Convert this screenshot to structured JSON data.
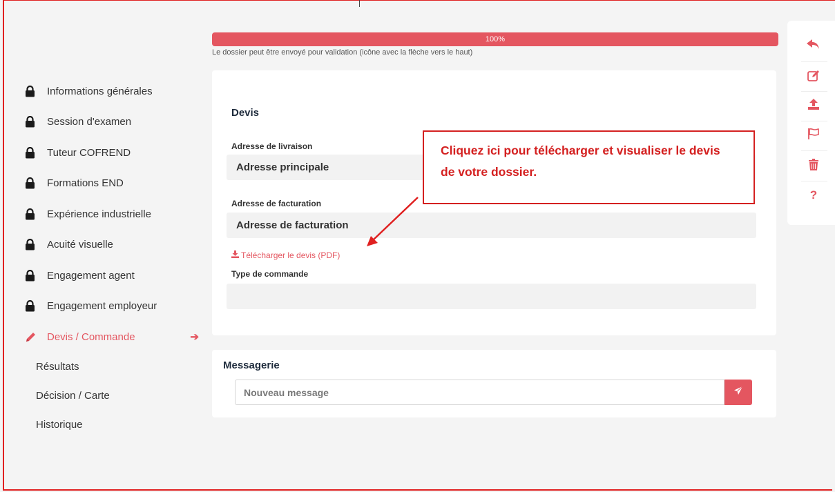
{
  "progress": {
    "percent": 100,
    "label": "100%",
    "note": "Le dossier peut être envoyé pour validation (icône avec la flèche vers le haut)"
  },
  "sidebar": {
    "items": [
      {
        "label": "Informations générales",
        "icon": "lock-icon"
      },
      {
        "label": "Session d'examen",
        "icon": "lock-icon"
      },
      {
        "label": "Tuteur COFREND",
        "icon": "lock-icon"
      },
      {
        "label": "Formations END",
        "icon": "lock-icon"
      },
      {
        "label": "Expérience industrielle",
        "icon": "lock-icon"
      },
      {
        "label": "Acuité visuelle",
        "icon": "lock-icon"
      },
      {
        "label": "Engagement agent",
        "icon": "lock-icon"
      },
      {
        "label": "Engagement employeur",
        "icon": "lock-icon"
      },
      {
        "label": "Devis / Commande",
        "icon": "pencil-icon",
        "active": true
      }
    ],
    "sub_items": [
      {
        "label": "Résultats"
      },
      {
        "label": "Décision / Carte"
      },
      {
        "label": "Historique"
      }
    ]
  },
  "devis": {
    "title": "Devis",
    "livraison": {
      "label": "Adresse de livraison",
      "value": "Adresse principale"
    },
    "facturation": {
      "label": "Adresse de facturation",
      "value": "Adresse de facturation"
    },
    "download_link": "Télécharger le devis (PDF)",
    "type_commande": {
      "label": "Type de commande",
      "value": ""
    }
  },
  "messagerie": {
    "title": "Messagerie",
    "placeholder": "Nouveau message"
  },
  "toolbar": {
    "tools": [
      "reply-icon",
      "edit-icon",
      "upload-icon",
      "flag-icon",
      "trash-icon",
      "question-icon"
    ]
  },
  "annotation": {
    "text": "Cliquez ici pour télécharger et visualiser le devis de votre dossier."
  },
  "colors": {
    "accent": "#e45660",
    "annotation": "#d42020"
  }
}
